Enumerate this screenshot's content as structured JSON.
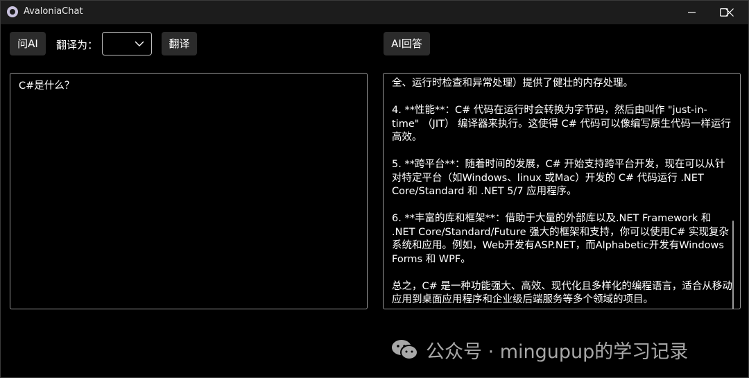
{
  "window": {
    "title": "AvaloniaChat"
  },
  "toolbar": {
    "ask_ai_label": "问AI",
    "translate_to_label": "翻译为：",
    "language_select_value": "",
    "translate_label": "翻译",
    "ai_answer_label": "AI回答"
  },
  "input": {
    "value": "C#是什么？"
  },
  "answer": {
    "paragraphs": [
      "全、运行时检查和异常处理）提供了健壮的内存处理。",
      "4. **性能**：C# 代码在运行时会转换为字节码，然后由叫作 \"just-in-time\" （JIT） 编译器来执行。这使得 C# 代码可以像编写原生代码一样运行高效。",
      "5. **跨平台**：随着时间的发展，C# 开始支持跨平台开发，现在可以从针对特定平台（如Windows、linux 或Mac）开发的 C# 代码运行 .NET Core/Standard 和 .NET 5/7 应用程序。",
      "6. **丰富的库和框架**：借助于大量的外部库以及.NET Framework 和 .NET Core/Standard/Future 强大的框架和支持，你可以使用C# 实现复杂系统和应用。例如，Web开发有ASP.NET，而Alphabetic开发有Windows Forms 和 WPF。",
      "总之，C# 是一种功能强大、高效、现代化且多样化的编程语言，适合从移动应用到桌面应用程序和企业级后端服务等多个领域的项目。"
    ]
  },
  "watermark": {
    "text": "公众号 · mingupup的学习记录",
    "icon": "wechat-icon"
  },
  "icons": {
    "app": "avalonia-logo-icon",
    "minimize": "minimize-icon",
    "maximize": "maximize-icon",
    "close": "close-icon",
    "dropdown": "chevron-down-icon"
  },
  "colors": {
    "background": "#000000",
    "titlebar": "#1c1c1c",
    "button": "#2b2b2b",
    "border": "#9a9a9a",
    "text": "#ffffff"
  }
}
